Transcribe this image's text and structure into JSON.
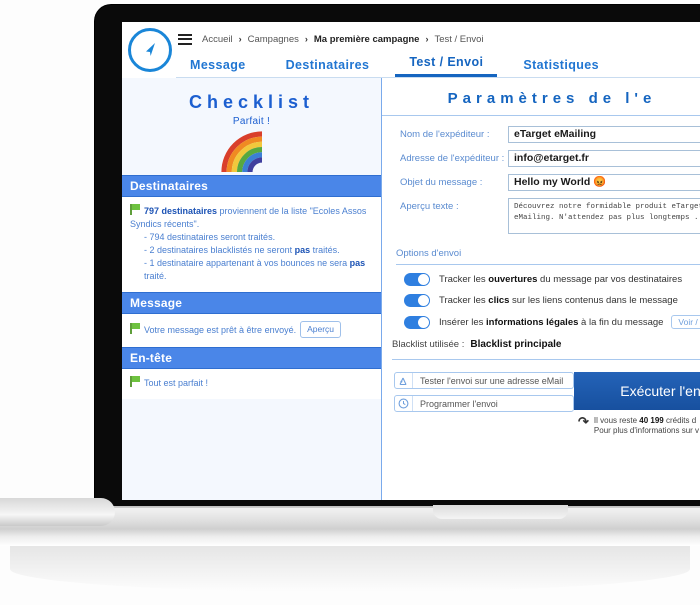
{
  "breadcrumb": {
    "menu_icon": "hamburger-icon",
    "items": [
      "Accueil",
      "Campagnes",
      "Ma première campagne",
      "Test / Envoi"
    ],
    "separator": "›"
  },
  "tabs": [
    {
      "label": "Message",
      "active": false
    },
    {
      "label": "Destinataires",
      "active": false
    },
    {
      "label": "Test / Envoi",
      "active": true
    },
    {
      "label": "Statistiques",
      "active": false
    }
  ],
  "logo": {
    "icon": "navigation-arrow-icon",
    "color": "#1a86d8"
  },
  "checklist": {
    "title": "Checklist",
    "subtitle": "Parfait !",
    "graphic": "rainbow-icon",
    "sections": [
      {
        "header": "Destinataires",
        "main_prefix": "797 destinataires",
        "main_rest": " proviennent de la liste \"Ecoles Assos Syndics récents\".",
        "details": [
          {
            "pre": "- 794 destinataires seront traités.",
            "bold": "",
            "post": ""
          },
          {
            "pre": "- 2 destinataires blacklistés ne seront ",
            "bold": "pas",
            "post": " traités."
          },
          {
            "pre": "- 1 destinataire appartenant à vos bounces ne sera ",
            "bold": "pas",
            "post": " traité."
          }
        ]
      },
      {
        "header": "Message",
        "main_prefix": "",
        "main_rest": "Votre message est prêt à être envoyé.",
        "button": "Aperçu",
        "details": []
      },
      {
        "header": "En-tête",
        "main_prefix": "",
        "main_rest": "Tout est parfait !",
        "details": []
      }
    ]
  },
  "params": {
    "title": "Paramètres de l'e",
    "fields": [
      {
        "label": "Nom de l'expéditeur :",
        "value": "eTarget eMailing",
        "type": "text"
      },
      {
        "label": "Adresse de l'expéditeur :",
        "value": "info@etarget.fr",
        "type": "text"
      },
      {
        "label": "Objet du message :",
        "value": "Hello my World 😡",
        "type": "text"
      },
      {
        "label": "Aperçu texte :",
        "value": "Découvrez notre formidable produit eTarget eMailing. N'attendez pas plus longtemps ...",
        "type": "textarea"
      }
    ],
    "options_label": "Options d'envoi",
    "options": [
      {
        "state": "on",
        "pre": "Tracker les ",
        "bold": "ouvertures",
        "post": " du message par vos destinataires",
        "button": ""
      },
      {
        "state": "on",
        "pre": "Tracker les ",
        "bold": "clics",
        "post": " sur les liens contenus dans le message",
        "button": ""
      },
      {
        "state": "on",
        "pre": "Insérer les ",
        "bold": "informations légales",
        "post": " à la fin du message",
        "button": "Voir / Mo"
      }
    ],
    "blacklist_label": "Blacklist utilisée :",
    "blacklist_value": "Blacklist principale"
  },
  "actions": {
    "test_button": {
      "label": "Tester l'envoi sur une adresse eMail",
      "icon": "test-send-icon"
    },
    "schedule_button": {
      "label": "Programmer l'envoi",
      "icon": "clock-icon"
    },
    "execute_button": {
      "label": "Exécuter l'env"
    },
    "credits": {
      "icon": "refresh-icon",
      "line1_pre": "Il vous reste ",
      "line1_bold": "40 199",
      "line1_post": " crédits d",
      "line2": "Pour plus d'informations sur v"
    }
  },
  "colors": {
    "accent_blue": "#2176d2",
    "section_header": "#4a86e8",
    "exec_button": "#1a5fb4",
    "toggle_on": "#2f7fe0",
    "left_panel_bg": "#f4f8fe"
  }
}
